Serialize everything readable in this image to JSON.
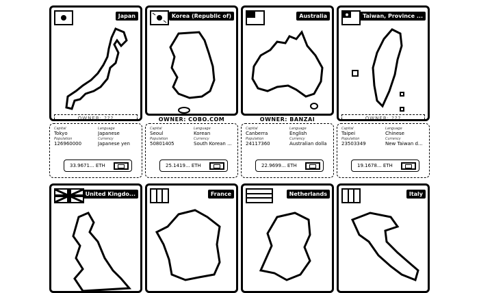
{
  "cards": [
    {
      "country": "Japan",
      "owner": "",
      "owner_bar": "OWNER: ???",
      "capital": "Tokyo",
      "language": "Japanese",
      "population": "126960000",
      "currency": "Japanese yen",
      "price": "33.9671... ETH"
    },
    {
      "country": "Korea (Republic of)",
      "owner": "OWNER: COBO.COM",
      "owner_bar": "",
      "capital": "Seoul",
      "language": "Korean",
      "population": "50801405",
      "currency": "South Korean ...",
      "price": "25.1419... ETH"
    },
    {
      "country": "Australia",
      "owner": "OWNER: BANZAI",
      "owner_bar": "",
      "capital": "Canberra",
      "language": "English",
      "population": "24117360",
      "currency": "Australian dolla",
      "price": "22.9699... ETH"
    },
    {
      "country": "Taiwan, Province ...",
      "owner": "",
      "owner_bar": "OWNER: ???",
      "capital": "Taipei",
      "language": "Chinese",
      "population": "23503349",
      "currency": "New Taiwan d...",
      "price": "19.1678... ETH"
    },
    {
      "country": "United Kingdo...",
      "owner": "",
      "owner_bar": ""
    },
    {
      "country": "France",
      "owner": "",
      "owner_bar": ""
    },
    {
      "country": "Netherlands",
      "owner": "",
      "owner_bar": ""
    },
    {
      "country": "Italy",
      "owner": "",
      "owner_bar": ""
    }
  ],
  "labels": {
    "capital": "Capital",
    "language": "Language",
    "population": "Population",
    "currency": "Currency"
  },
  "icons": {
    "buy": "wallet-icon"
  }
}
